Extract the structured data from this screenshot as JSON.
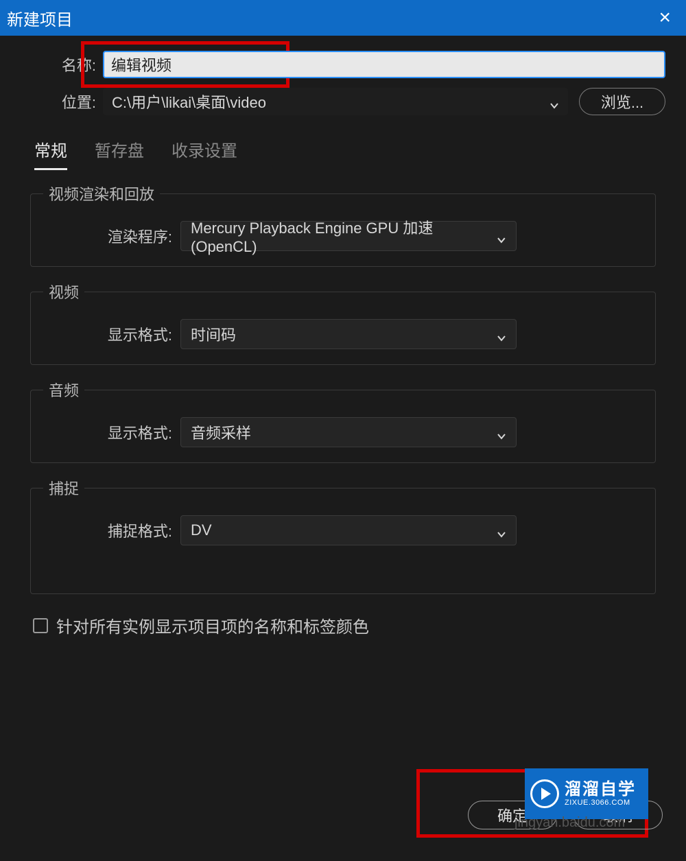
{
  "titlebar": {
    "title": "新建项目"
  },
  "form": {
    "name_label": "名称:",
    "name_value": "编辑视频",
    "location_label": "位置:",
    "location_value": "C:\\用户\\likai\\桌面\\video",
    "browse_label": "浏览..."
  },
  "tabs": {
    "general": "常规",
    "scratch": "暂存盘",
    "ingest": "收录设置"
  },
  "groups": {
    "render": {
      "legend": "视频渲染和回放",
      "renderer_label": "渲染程序:",
      "renderer_value": "Mercury Playback Engine GPU 加速 (OpenCL)"
    },
    "video": {
      "legend": "视频",
      "format_label": "显示格式:",
      "format_value": "时间码"
    },
    "audio": {
      "legend": "音频",
      "format_label": "显示格式:",
      "format_value": "音频采样"
    },
    "capture": {
      "legend": "捕捉",
      "format_label": "捕捉格式:",
      "format_value": "DV"
    }
  },
  "checkbox": {
    "label": "针对所有实例显示项目项的名称和标签颜色"
  },
  "footer": {
    "ok": "确定",
    "cancel": "取消"
  },
  "watermark": {
    "brand": "溜溜自学",
    "url": "ZIXUE.3066.COM",
    "faint": "jingyan.baidu.com"
  }
}
